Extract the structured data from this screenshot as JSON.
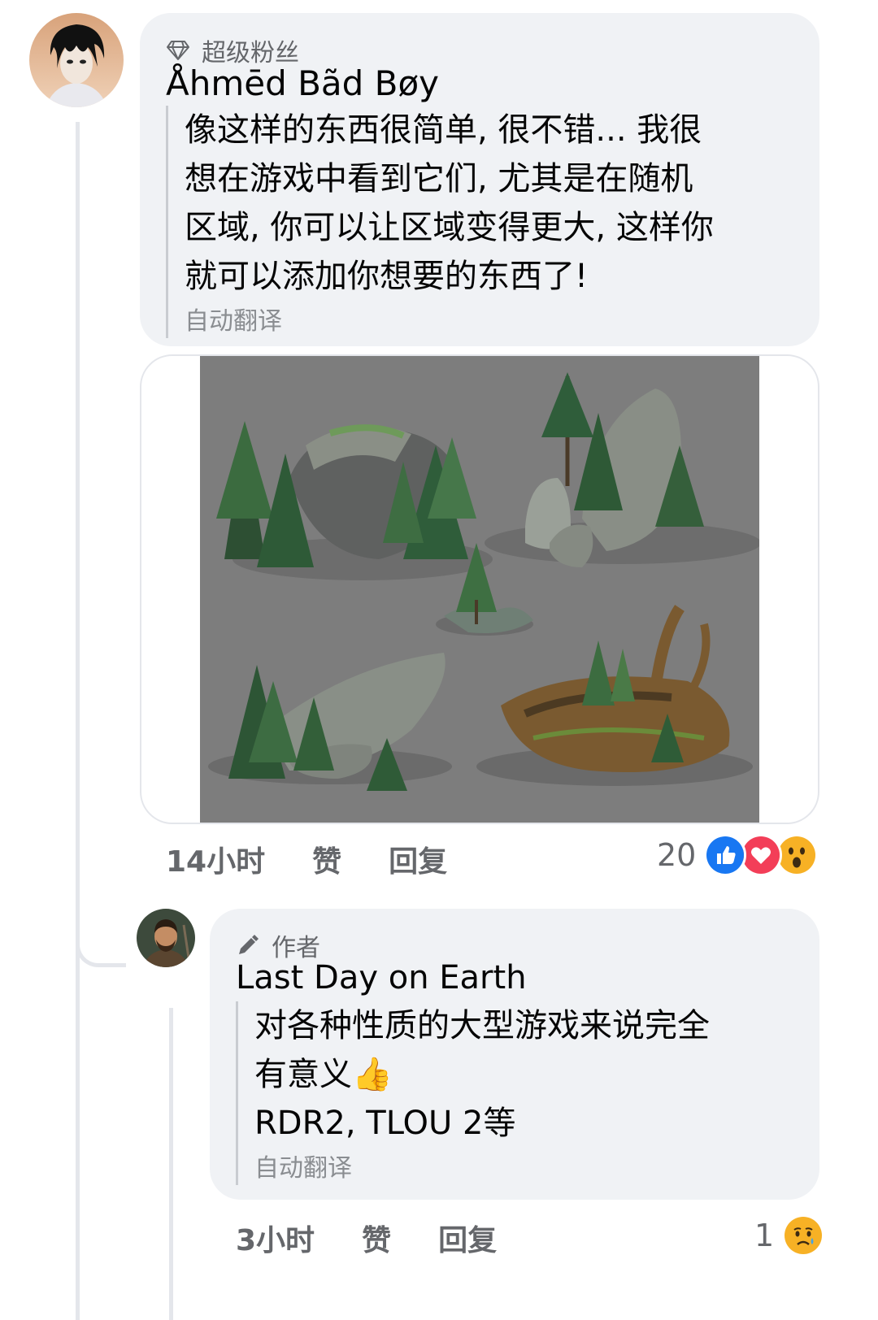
{
  "comment": {
    "badge": "超级粉丝",
    "author": "Åhmēd Bãd Bøy",
    "text_lines": [
      "像这样的东西很简单, 很不错... 我很",
      "想在游戏中看到它们, 尤其是在随机",
      "区域, 你可以让区域变得更大, 这样你",
      "就可以添加你想要的东西了!"
    ],
    "auto_translate": "自动翻译",
    "time": "14小时",
    "like": "赞",
    "reply": "回复",
    "reaction_count": "20",
    "reactions": [
      "like-icon",
      "love-icon",
      "wow-icon"
    ]
  },
  "reply": {
    "badge": "作者",
    "author": "Last Day on Earth",
    "text_lines": [
      "对各种性质的大型游戏来说完全",
      "有意义👍",
      "RDR2, TLOU 2等"
    ],
    "auto_translate": "自动翻译",
    "time": "3小时",
    "like": "赞",
    "reply": "回复",
    "reaction_count": "1",
    "reactions": [
      "sad-icon"
    ]
  },
  "colors": {
    "bubble": "#f0f2f5",
    "secondary_text": "#65676b",
    "like_blue": "#1877f2",
    "love_red": "#f33e58",
    "wow_yellow": "#f7b125",
    "image_background": "#7d7d7d"
  }
}
